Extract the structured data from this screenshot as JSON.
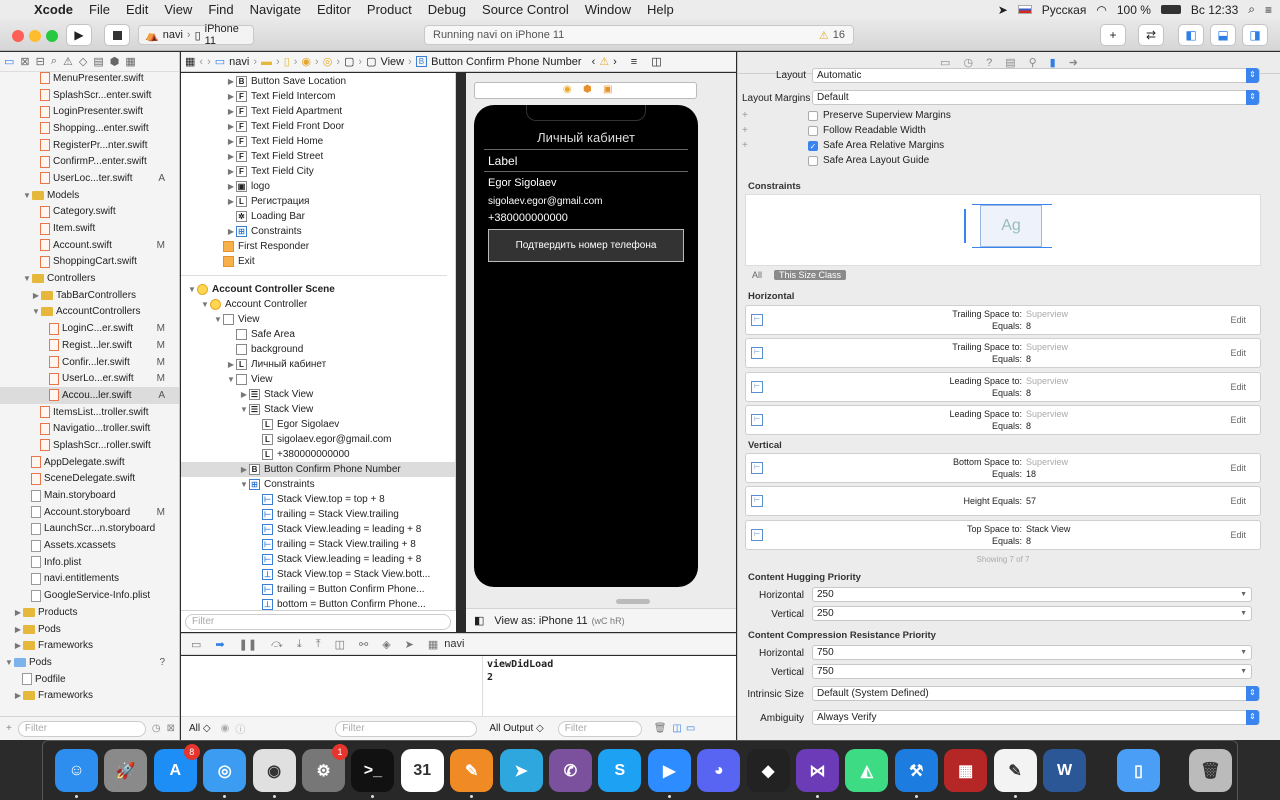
{
  "menubar": {
    "app": "Xcode",
    "items": [
      "File",
      "Edit",
      "View",
      "Find",
      "Navigate",
      "Editor",
      "Product",
      "Debug",
      "Source Control",
      "Window",
      "Help"
    ],
    "lang": "Русская",
    "battery": "100 %",
    "clock": "Вс 12:33"
  },
  "toolbar": {
    "scheme": "navi",
    "device": "iPhone 11",
    "status": "Running navi on iPhone 11",
    "warnings": "16"
  },
  "navigator": {
    "files": [
      {
        "name": "MenuPresenter.swift",
        "status": "",
        "indent": 4,
        "kind": "swift"
      },
      {
        "name": "SplashScr...enter.swift",
        "status": "",
        "indent": 4,
        "kind": "swift"
      },
      {
        "name": "LoginPresenter.swift",
        "status": "",
        "indent": 4,
        "kind": "swift"
      },
      {
        "name": "Shopping...enter.swift",
        "status": "",
        "indent": 4,
        "kind": "swift"
      },
      {
        "name": "RegisterPr...nter.swift",
        "status": "",
        "indent": 4,
        "kind": "swift"
      },
      {
        "name": "ConfirmP...enter.swift",
        "status": "",
        "indent": 4,
        "kind": "swift"
      },
      {
        "name": "UserLoc...ter.swift",
        "status": "A",
        "indent": 4,
        "kind": "swift"
      },
      {
        "name": "Models",
        "status": "",
        "indent": 2,
        "kind": "folder",
        "open": true
      },
      {
        "name": "Category.swift",
        "status": "",
        "indent": 4,
        "kind": "swift"
      },
      {
        "name": "Item.swift",
        "status": "",
        "indent": 4,
        "kind": "swift"
      },
      {
        "name": "Account.swift",
        "status": "M",
        "indent": 4,
        "kind": "swift"
      },
      {
        "name": "ShoppingCart.swift",
        "status": "",
        "indent": 4,
        "kind": "swift"
      },
      {
        "name": "Controllers",
        "status": "",
        "indent": 2,
        "kind": "folder",
        "open": true
      },
      {
        "name": "TabBarControllers",
        "status": "",
        "indent": 3,
        "kind": "folder",
        "open": false
      },
      {
        "name": "AccountControllers",
        "status": "",
        "indent": 3,
        "kind": "folder",
        "open": true
      },
      {
        "name": "LoginC...er.swift",
        "status": "M",
        "indent": 5,
        "kind": "swift"
      },
      {
        "name": "Regist...ler.swift",
        "status": "M",
        "indent": 5,
        "kind": "swift"
      },
      {
        "name": "Confir...ler.swift",
        "status": "M",
        "indent": 5,
        "kind": "swift"
      },
      {
        "name": "UserLo...er.swift",
        "status": "M",
        "indent": 5,
        "kind": "swift"
      },
      {
        "name": "Accou...ler.swift",
        "status": "A",
        "indent": 5,
        "kind": "swift",
        "selected": true
      },
      {
        "name": "ItemsList...troller.swift",
        "status": "",
        "indent": 4,
        "kind": "swift"
      },
      {
        "name": "Navigatio...troller.swift",
        "status": "",
        "indent": 4,
        "kind": "swift"
      },
      {
        "name": "SplashScr...roller.swift",
        "status": "",
        "indent": 4,
        "kind": "swift"
      },
      {
        "name": "AppDelegate.swift",
        "status": "",
        "indent": 3,
        "kind": "swift"
      },
      {
        "name": "SceneDelegate.swift",
        "status": "",
        "indent": 3,
        "kind": "swift"
      },
      {
        "name": "Main.storyboard",
        "status": "",
        "indent": 3,
        "kind": "file"
      },
      {
        "name": "Account.storyboard",
        "status": "M",
        "indent": 3,
        "kind": "file"
      },
      {
        "name": "LaunchScr...n.storyboard",
        "status": "",
        "indent": 3,
        "kind": "file"
      },
      {
        "name": "Assets.xcassets",
        "status": "",
        "indent": 3,
        "kind": "assets"
      },
      {
        "name": "Info.plist",
        "status": "",
        "indent": 3,
        "kind": "file"
      },
      {
        "name": "navi.entitlements",
        "status": "",
        "indent": 3,
        "kind": "file"
      },
      {
        "name": "GoogleService-Info.plist",
        "status": "",
        "indent": 3,
        "kind": "file"
      },
      {
        "name": "Products",
        "status": "",
        "indent": 1,
        "kind": "folder",
        "open": false
      },
      {
        "name": "Pods",
        "status": "",
        "indent": 1,
        "kind": "folder",
        "open": false
      },
      {
        "name": "Frameworks",
        "status": "",
        "indent": 1,
        "kind": "folder",
        "open": false
      },
      {
        "name": "Pods",
        "status": "?",
        "indent": 0,
        "kind": "project",
        "open": true
      },
      {
        "name": "Podfile",
        "status": "",
        "indent": 2,
        "kind": "file"
      },
      {
        "name": "Frameworks",
        "status": "",
        "indent": 1,
        "kind": "folder",
        "open": false
      }
    ],
    "filter_placeholder": "Filter"
  },
  "jumpbar": {
    "crumbs": [
      "navi",
      "",
      "",
      "",
      "",
      "View",
      "Button Confirm Phone Number"
    ]
  },
  "outline": {
    "rows": [
      {
        "text": "Button Save Location",
        "badge": "B",
        "indent": 3,
        "tri": "▶"
      },
      {
        "text": "Text Field Intercom",
        "badge": "F",
        "indent": 3,
        "tri": "▶"
      },
      {
        "text": "Text Field Apartment",
        "badge": "F",
        "indent": 3,
        "tri": "▶"
      },
      {
        "text": "Text Field Front Door",
        "badge": "F",
        "indent": 3,
        "tri": "▶"
      },
      {
        "text": "Text Field Home",
        "badge": "F",
        "indent": 3,
        "tri": "▶"
      },
      {
        "text": "Text Field Street",
        "badge": "F",
        "indent": 3,
        "tri": "▶"
      },
      {
        "text": "Text Field City",
        "badge": "F",
        "indent": 3,
        "tri": "▶"
      },
      {
        "text": "logo",
        "badge": "▣",
        "indent": 3,
        "tri": "▶"
      },
      {
        "text": "Регистрация",
        "badge": "L",
        "indent": 3,
        "tri": "▶"
      },
      {
        "text": "Loading Bar",
        "badge": "✲",
        "indent": 3,
        "tri": ""
      },
      {
        "text": "Constraints",
        "badge": "⊞",
        "indent": 3,
        "tri": "▶",
        "kind": "cn"
      },
      {
        "text": "First Responder",
        "badge": "",
        "indent": 2,
        "tri": "",
        "kind": "fr"
      },
      {
        "text": "Exit",
        "badge": "",
        "indent": 2,
        "tri": "",
        "kind": "fr"
      },
      {
        "text": "",
        "badge": "",
        "indent": 0,
        "tri": "",
        "kind": "spacer"
      },
      {
        "text": "Account Controller Scene",
        "badge": "",
        "indent": 0,
        "tri": "▼",
        "kind": "scene",
        "hdr": true
      },
      {
        "text": "Account Controller",
        "badge": "",
        "indent": 1,
        "tri": "▼",
        "kind": "sc"
      },
      {
        "text": "View",
        "badge": "",
        "indent": 2,
        "tri": "▼"
      },
      {
        "text": "Safe Area",
        "badge": "",
        "indent": 3,
        "tri": ""
      },
      {
        "text": "background",
        "badge": "",
        "indent": 3,
        "tri": ""
      },
      {
        "text": "Личный кабинет",
        "badge": "L",
        "indent": 3,
        "tri": "▶"
      },
      {
        "text": "View",
        "badge": "",
        "indent": 3,
        "tri": "▼"
      },
      {
        "text": "Stack View",
        "badge": "☰",
        "indent": 4,
        "tri": "▶"
      },
      {
        "text": "Stack View",
        "badge": "☰",
        "indent": 4,
        "tri": "▼"
      },
      {
        "text": "Egor Sigolaev",
        "badge": "L",
        "indent": 5,
        "tri": ""
      },
      {
        "text": "sigolaev.egor@gmail.com",
        "badge": "L",
        "indent": 5,
        "tri": ""
      },
      {
        "text": "+380000000000",
        "badge": "L",
        "indent": 5,
        "tri": ""
      },
      {
        "text": "Button Confirm Phone Number",
        "badge": "B",
        "indent": 4,
        "tri": "▶",
        "selected": true
      },
      {
        "text": "Constraints",
        "badge": "⊞",
        "indent": 4,
        "tri": "▼",
        "kind": "cn"
      },
      {
        "text": "Stack View.top = top + 8",
        "badge": "⊢",
        "indent": 5,
        "tri": "",
        "kind": "cn"
      },
      {
        "text": "trailing = Stack View.trailing",
        "badge": "⊢",
        "indent": 5,
        "tri": "",
        "kind": "cn"
      },
      {
        "text": "Stack View.leading = leading + 8",
        "badge": "⊢",
        "indent": 5,
        "tri": "",
        "kind": "cn"
      },
      {
        "text": "trailing = Stack View.trailing + 8",
        "badge": "⊢",
        "indent": 5,
        "tri": "",
        "kind": "cn"
      },
      {
        "text": "Stack View.leading = leading + 8",
        "badge": "⊢",
        "indent": 5,
        "tri": "",
        "kind": "cn"
      },
      {
        "text": "Stack View.top = Stack View.bott...",
        "badge": "⊥",
        "indent": 5,
        "tri": "",
        "kind": "cn"
      },
      {
        "text": "trailing = Button Confirm Phone...",
        "badge": "⊢",
        "indent": 5,
        "tri": "",
        "kind": "cn"
      },
      {
        "text": "bottom = Button Confirm Phone...",
        "badge": "⊥",
        "indent": 5,
        "tri": "",
        "kind": "cn"
      }
    ],
    "filter_placeholder": "Filter"
  },
  "phone": {
    "title": "Личный кабинет",
    "label": "Label",
    "name": "Egor Sigolaev",
    "email": "sigolaev.egor@gmail.com",
    "phone": "+380000000000",
    "button": "Подтвердить номер телефона"
  },
  "canvas": {
    "view_as": "View as: iPhone 11",
    "traits": "(wC hR)"
  },
  "debug": {
    "target": "navi",
    "console": "viewDidLoad\n2",
    "all_label": "All ◇",
    "output_label": "All Output ◇",
    "filter": "Filter"
  },
  "inspector": {
    "layout_label": "Layout",
    "layout_value": "Automatic",
    "margins_label": "Layout Margins",
    "margins_value": "Default",
    "checks": [
      {
        "label": "Preserve Superview Margins",
        "on": false
      },
      {
        "label": "Follow Readable Width",
        "on": false
      },
      {
        "label": "Safe Area Relative Margins",
        "on": true
      },
      {
        "label": "Safe Area Layout Guide",
        "on": false
      }
    ],
    "constraints_title": "Constraints",
    "preview_text": "Ag",
    "seg_all": "All",
    "seg_size": "This Size Class",
    "horizontal_title": "Horizontal",
    "vertical_title": "Vertical",
    "horizontal": [
      {
        "l1": "Trailing Space to:",
        "t1": "Superview",
        "l2": "Equals:",
        "v2": "8"
      },
      {
        "l1": "Trailing Space to:",
        "t1": "Superview",
        "l2": "Equals:",
        "v2": "8"
      },
      {
        "l1": "Leading Space to:",
        "t1": "Superview",
        "l2": "Equals:",
        "v2": "8"
      },
      {
        "l1": "Leading Space to:",
        "t1": "Superview",
        "l2": "Equals:",
        "v2": "8"
      }
    ],
    "vertical": [
      {
        "l1": "Bottom Space to:",
        "t1": "Superview",
        "l2": "Equals:",
        "v2": "18"
      },
      {
        "l1": "",
        "t1": "",
        "l2": "Height Equals:",
        "v2": "57"
      },
      {
        "l1": "Top Space to:",
        "t1": "Stack View",
        "l2": "Equals:",
        "v2": "8",
        "dark": true
      }
    ],
    "edit": "Edit",
    "showing": "Showing 7 of 7",
    "hugging_title": "Content Hugging Priority",
    "compression_title": "Content Compression Resistance Priority",
    "horizontal_label": "Horizontal",
    "vertical_label": "Vertical",
    "hug_h": "250",
    "hug_v": "250",
    "comp_h": "750",
    "comp_v": "750",
    "intrinsic_label": "Intrinsic Size",
    "intrinsic_value": "Default (System Defined)",
    "ambiguity_label": "Ambiguity",
    "ambiguity_value": "Always Verify"
  },
  "dock": {
    "apps": [
      {
        "name": "Finder",
        "color": "#2d8ef0",
        "glyph": "☺"
      },
      {
        "name": "Launchpad",
        "color": "#8a8a8a",
        "glyph": "🚀"
      },
      {
        "name": "App Store",
        "color": "#1c8ef5",
        "glyph": "A",
        "badge": "8"
      },
      {
        "name": "Safari",
        "color": "#3b9cf2",
        "glyph": "◎"
      },
      {
        "name": "Chrome",
        "color": "#e0e0e0",
        "glyph": "◉"
      },
      {
        "name": "System Preferences",
        "color": "#777",
        "glyph": "⚙",
        "badge": "1"
      },
      {
        "name": "Terminal",
        "color": "#111",
        "glyph": ">_"
      },
      {
        "name": "Calendar",
        "color": "#fff",
        "glyph": "31"
      },
      {
        "name": "Pages",
        "color": "#f08a24",
        "glyph": "✎"
      },
      {
        "name": "Telegram",
        "color": "#2ea6de",
        "glyph": "➤"
      },
      {
        "name": "Viber",
        "color": "#7b519d",
        "glyph": "✆"
      },
      {
        "name": "Skype",
        "color": "#1da1f2",
        "glyph": "S"
      },
      {
        "name": "Zoom",
        "color": "#2d8cff",
        "glyph": "▶"
      },
      {
        "name": "Discord",
        "color": "#5865f2",
        "glyph": "◕"
      },
      {
        "name": "Unity",
        "color": "#222",
        "glyph": "◆"
      },
      {
        "name": "Visual Studio",
        "color": "#6c3bb8",
        "glyph": "⋈"
      },
      {
        "name": "Android Studio",
        "color": "#3ddc84",
        "glyph": "◭"
      },
      {
        "name": "Xcode",
        "color": "#1d7ce0",
        "glyph": "⚒"
      },
      {
        "name": "Photo Booth",
        "color": "#b52626",
        "glyph": "▦"
      },
      {
        "name": "TextEdit",
        "color": "#f3f3f3",
        "glyph": "✎"
      },
      {
        "name": "Word",
        "color": "#2b5797",
        "glyph": "W"
      },
      {
        "name": "Simulator",
        "color": "#4a9ef5",
        "glyph": "▯"
      },
      {
        "name": "Trash",
        "color": "#bbb",
        "glyph": "🗑"
      }
    ]
  }
}
